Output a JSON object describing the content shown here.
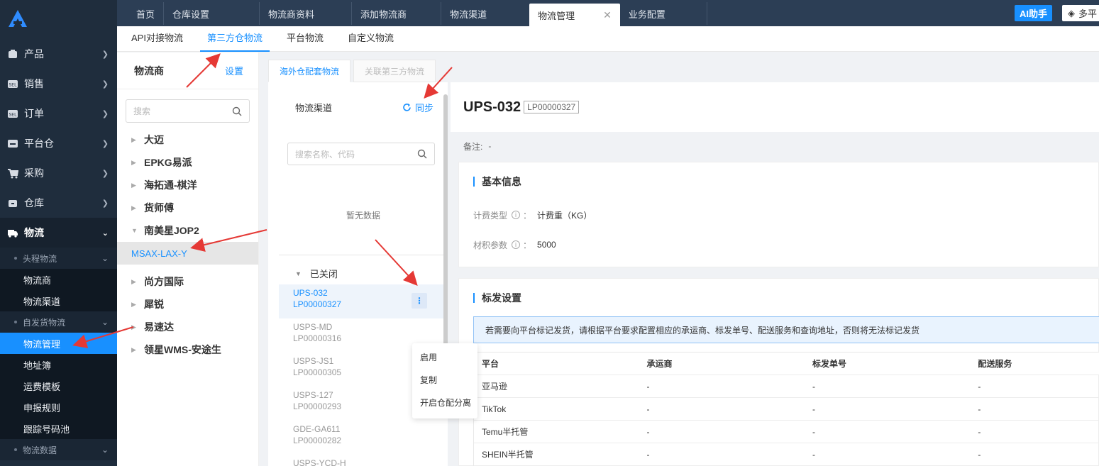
{
  "sidebar": {
    "items": [
      {
        "label": "产品",
        "icon": "box-icon"
      },
      {
        "label": "销售",
        "icon": "sell-icon"
      },
      {
        "label": "订单",
        "icon": "sell-icon"
      },
      {
        "label": "平台仓",
        "icon": "warehouse-icon"
      },
      {
        "label": "采购",
        "icon": "cart-icon"
      },
      {
        "label": "仓库",
        "icon": "box-icon"
      },
      {
        "label": "物流",
        "icon": "truck-icon"
      }
    ],
    "group1": "头程物流",
    "group1_items": [
      "物流商",
      "物流渠道"
    ],
    "group2": "自发货物流",
    "group2_items": [
      "物流管理",
      "地址簿",
      "运费模板",
      "申报规则",
      "跟踪号码池"
    ],
    "group3": "物流数据"
  },
  "topbar": {
    "tabs": [
      "首页",
      "仓库设置",
      "物流商资料",
      "添加物流商",
      "物流渠道",
      "物流管理",
      "业务配置"
    ],
    "ai_label": "AI助手",
    "multi_label": "多平"
  },
  "subtabs": [
    "API对接物流",
    "第三方仓物流",
    "平台物流",
    "自定义物流"
  ],
  "provider": {
    "title": "物流商",
    "settings": "设置",
    "search_placeholder": "搜索",
    "nodes": [
      "大迈",
      "EPKG易派",
      "海拓通-棋洋",
      "货师傅",
      "南美星JOP2"
    ],
    "leaf": "MSAX-LAX-Y",
    "nodes2": [
      "尚方国际",
      "犀锐",
      "易速达",
      "领星WMS-安途生"
    ]
  },
  "content_tabs": [
    "海外仓配套物流",
    "关联第三方物流"
  ],
  "channel": {
    "title": "物流渠道",
    "sync": "同步",
    "search_placeholder": "搜索名称、代码",
    "empty": "暂无数据",
    "closed_label": "已关闭",
    "items": [
      {
        "name": "UPS-032",
        "code": "LP00000327"
      },
      {
        "name": "USPS-MD",
        "code": "LP00000316"
      },
      {
        "name": "USPS-JS1",
        "code": "LP00000305"
      },
      {
        "name": "USPS-127",
        "code": "LP00000293"
      },
      {
        "name": "GDE-GA611",
        "code": "LP00000282"
      },
      {
        "name": "USPS-YCD-H",
        "code": ""
      }
    ],
    "menu": [
      "启用",
      "复制",
      "开启仓配分离"
    ]
  },
  "detail": {
    "name": "UPS-032",
    "code": "LP00000327",
    "note_label": "备注:",
    "note_value": "-",
    "basic_title": "基本信息",
    "billing_label": "计费类型",
    "billing_value": "计费重（KG）",
    "volume_label": "材积参数",
    "volume_value": "5000",
    "colon": "：",
    "mark_title": "标发设置",
    "alert": "若需要向平台标记发货，请根据平台要求配置相应的承运商、标发单号、配送服务和查询地址，否则将无法标记发货",
    "table_headers": [
      "平台",
      "承运商",
      "标发单号",
      "配送服务"
    ],
    "rows": [
      [
        "亚马逊",
        "-",
        "-",
        "-"
      ],
      [
        "TikTok",
        "-",
        "-",
        "-"
      ],
      [
        "Temu半托管",
        "-",
        "-",
        "-"
      ],
      [
        "SHEIN半托管",
        "-",
        "-",
        "-"
      ]
    ]
  },
  "colors": {
    "accent": "#1890ff",
    "sidebar": "#1f2d3d",
    "arrow": "#e53935"
  }
}
